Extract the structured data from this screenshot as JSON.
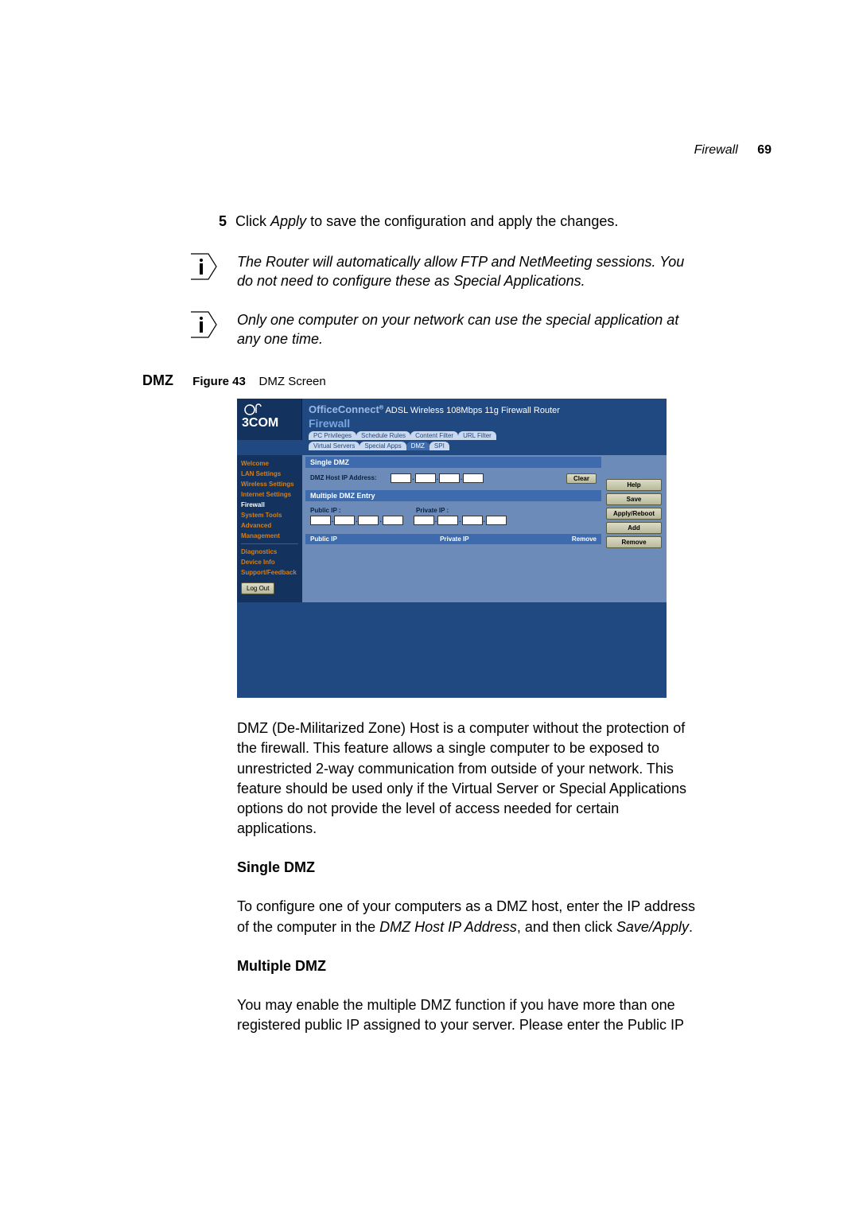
{
  "header": {
    "section": "Firewall",
    "page": "69"
  },
  "step": {
    "num": "5",
    "prefix": "Click ",
    "button": "Apply",
    "suffix": " to save the configuration and apply the changes."
  },
  "notes": {
    "n1": "The Router will automatically allow FTP and NetMeeting sessions. You do not need to configure these as Special Applications.",
    "n2": "Only one computer on your network can use the special application at any one time."
  },
  "sidehead": "DMZ",
  "figure": {
    "label": "Figure 43",
    "caption": "DMZ Screen"
  },
  "ss": {
    "logo": "3COM",
    "productline_brand": "OfficeConnect",
    "productline_rest": "ADSL Wireless 108Mbps 11g Firewall Router",
    "section_title": "Firewall",
    "tabs_row1": [
      "PC Privileges",
      "Schedule Rules",
      "Content Filter",
      "URL Filter"
    ],
    "tabs_row2": [
      "Virtual Servers",
      "Special Apps",
      "DMZ",
      "SPI"
    ],
    "active_tab": "DMZ",
    "nav": [
      "Welcome",
      "LAN Settings",
      "Wireless Settings",
      "Internet Settings",
      "Firewall",
      "System Tools",
      "Advanced",
      "Management"
    ],
    "nav_sub": [
      "Diagnostics",
      "Device Info",
      "Support/Feedback"
    ],
    "logout": "Log Out",
    "panel1_title": "Single DMZ",
    "panel1_label": "DMZ Host IP Address:",
    "panel2_title": "Multiple DMZ Entry",
    "panel2_pub": "Public IP :",
    "panel2_prv": "Private IP :",
    "table_cols": [
      "Public IP",
      "Private IP",
      "Remove"
    ],
    "right_buttons": [
      "Help",
      "Save",
      "Apply/Reboot",
      "Add",
      "Remove"
    ],
    "clear_btn": "Clear"
  },
  "para": {
    "p1": "DMZ (De-Militarized Zone) Host is a computer without the protection of the firewall. This feature allows a single computer to be exposed to unrestricted 2-way communication from outside of your network. This feature should be used only if the Virtual Server or Special Applications options do not provide the level of access needed for certain applications.",
    "h1": "Single DMZ",
    "p2a": "To configure one of your computers as a DMZ host, enter the IP address of the computer in the ",
    "p2i": "DMZ Host IP Address",
    "p2b": ", and then click ",
    "p2i2": "Save/Apply",
    "p2c": ".",
    "h2": "Multiple DMZ",
    "p3": "You may enable the multiple DMZ function if you have more than one registered public IP assigned to your server. Please enter the Public IP"
  }
}
